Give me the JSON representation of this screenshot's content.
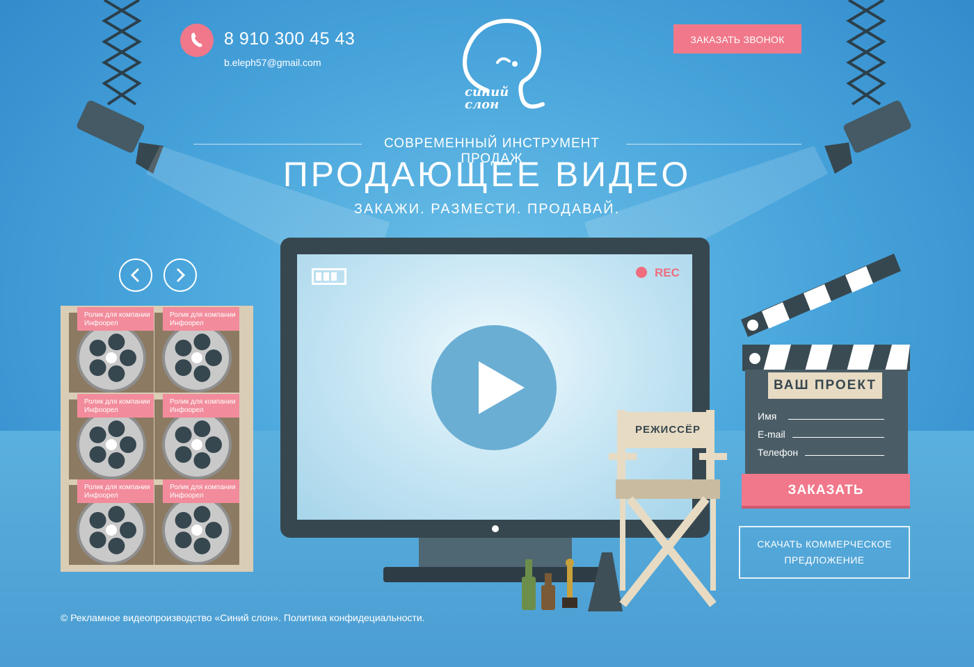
{
  "header": {
    "phone": "8 910 300 45 43",
    "email": "b.eleph57@gmail.com",
    "call_button": "ЗАКАЗАТЬ ЗВОНОК",
    "logo_text_line1": "синий",
    "logo_text_line2": "слон"
  },
  "hero": {
    "tagline": "СОВРЕМЕННЫЙ ИНСТРУМЕНТ ПРОДАЖ",
    "title": "ПРОДАЮЩЕЕ ВИДЕО",
    "slogan": "ЗАКАЖИ. РАЗМЕСТИ. ПРОДАВАЙ."
  },
  "monitor": {
    "rec_label": "REC"
  },
  "portfolio": {
    "items": [
      {
        "label": "Ролик для компании Инфоорел"
      },
      {
        "label": "Ролик для компании Инфоорел"
      },
      {
        "label": "Ролик для компании Инфоорел"
      },
      {
        "label": "Ролик для компании Инфоорел"
      },
      {
        "label": "Ролик для компании Инфоорел"
      },
      {
        "label": "Ролик для компании Инфоорел"
      }
    ]
  },
  "chair": {
    "sign": "РЕЖИССЁР"
  },
  "order_form": {
    "title": "ВАШ ПРОЕКТ",
    "name_label": "Имя",
    "email_label": "E-mail",
    "phone_label": "Телефон",
    "submit": "ЗАКАЗАТЬ",
    "download": "СКАЧАТЬ КОММЕРЧЕСКОЕ ПРЕДЛОЖЕНИЕ"
  },
  "footer": {
    "text": "© Рекламное видеопроизводство «Синий слон». Политика конфидециальности."
  },
  "colors": {
    "accent": "#f0788a",
    "dark": "#37474f",
    "background": "#4aa6dc"
  }
}
